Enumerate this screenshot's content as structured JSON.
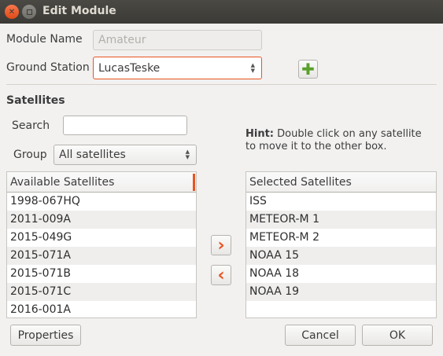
{
  "window": {
    "title": "Edit Module"
  },
  "form": {
    "module_name_label": "Module Name",
    "module_name_value": "Amateur",
    "ground_station_label": "Ground Station",
    "ground_station_value": "LucasTeske"
  },
  "satellites": {
    "section_label": "Satellites",
    "search_label": "Search",
    "search_value": "",
    "group_label": "Group",
    "group_value": "All satellites",
    "hint_bold": "Hint:",
    "hint_line1": " Double click on any satellite",
    "hint_line2": "to move it to the other box.",
    "available": {
      "header": "Available Satellites",
      "items": [
        "1998-067HQ",
        "2011-009A",
        "2015-049G",
        "2015-071A",
        "2015-071B",
        "2015-071C",
        "2016-001A"
      ]
    },
    "selected": {
      "header": "Selected Satellites",
      "items": [
        "ISS",
        "METEOR-M 1",
        "METEOR-M 2",
        "NOAA 15",
        "NOAA 18",
        "NOAA 19"
      ]
    }
  },
  "buttons": {
    "add": "›",
    "remove": "‹",
    "properties": "Properties",
    "cancel": "Cancel",
    "ok": "OK"
  },
  "colors": {
    "accent": "#e95420",
    "add_green": "#5aa02c"
  }
}
